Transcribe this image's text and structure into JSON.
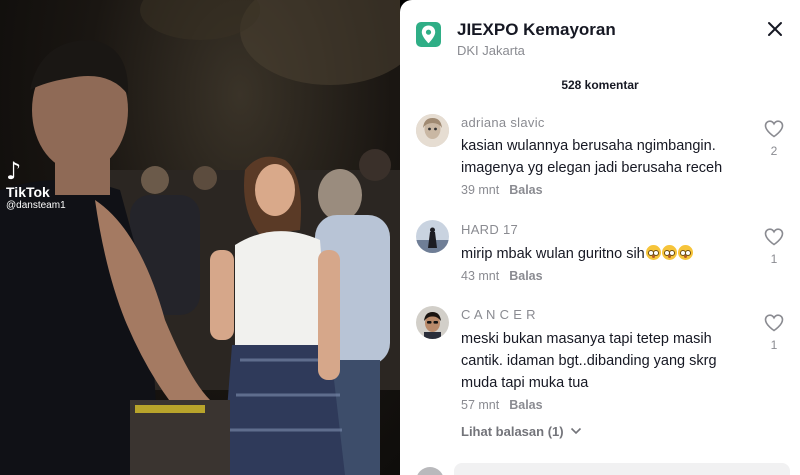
{
  "video": {
    "watermark_logo": "♪",
    "watermark_name": "TikTok",
    "watermark_handle": "@dansteam1"
  },
  "panel": {
    "location_icon": "location-pin-icon",
    "location_title": "JIEXPO Kemayoran",
    "location_subtitle": "DKI Jakarta",
    "comment_count": "528 komentar",
    "reply_label": "Balas",
    "view_replies": "Lihat balasan (1)"
  },
  "comments": [
    {
      "username": "adriana slavic",
      "text": "kasian wulannya berusaha ngimbangin. imagenya yg elegan jadi berusaha receh",
      "time": "39 mnt",
      "likes": "2"
    },
    {
      "username": "HARD 17",
      "text": "mirip mbak wulan guritno sih",
      "time": "43 mnt",
      "likes": "1"
    },
    {
      "username": "C A N C E R",
      "text": "meski bukan masanya tapi tetep masih cantik. idaman bgt..dibanding yang skrg muda tapi muka tua",
      "time": "57 mnt",
      "likes": "1"
    }
  ],
  "colors": {
    "accent_location": "#2fae86",
    "text_primary": "#161823",
    "text_secondary": "#8a8b91"
  }
}
